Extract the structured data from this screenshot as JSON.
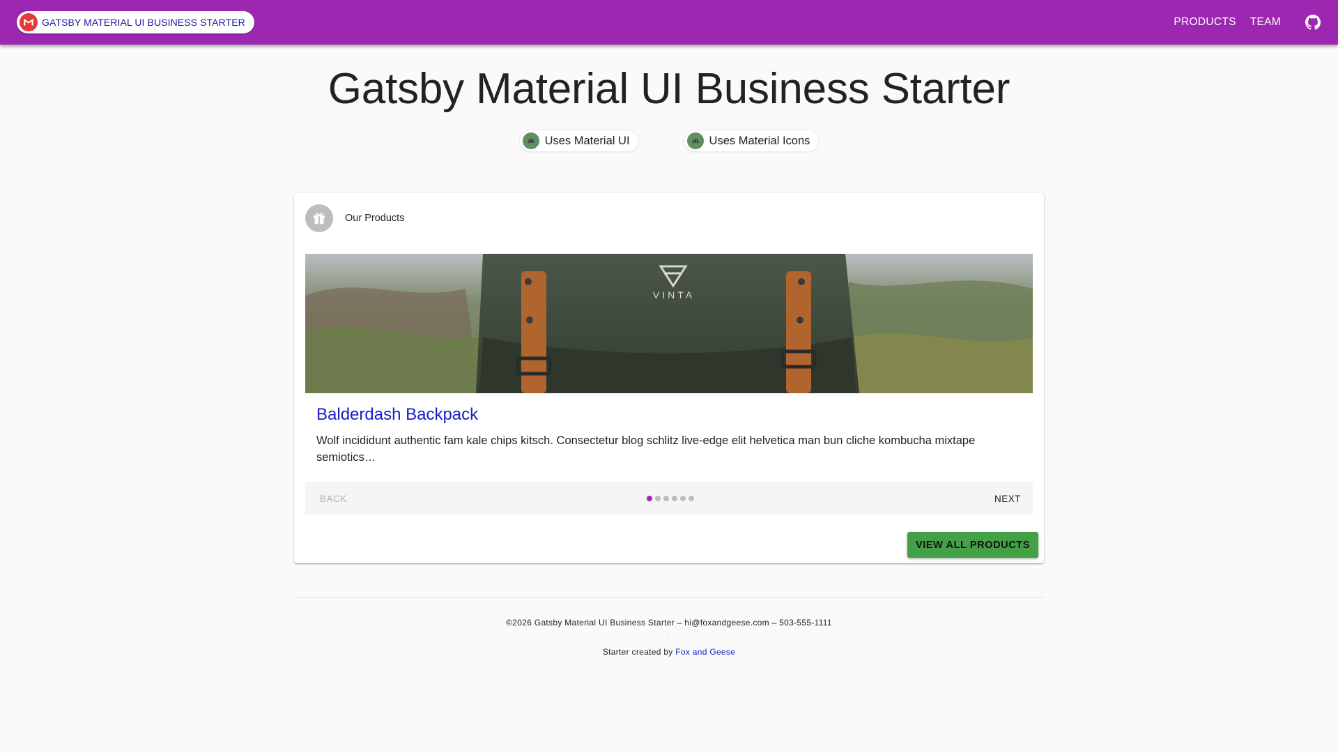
{
  "appbar": {
    "brand_label": "GATSBY MATERIAL UI BUSINESS STARTER",
    "brand_icon": "material-ui-logo-icon",
    "nav": [
      {
        "label": "PRODUCTS"
      },
      {
        "label": "TEAM"
      }
    ],
    "github_icon": "github-icon",
    "color": "#9c27b0"
  },
  "hero": {
    "title": "Gatsby Material UI Business Starter",
    "chips": [
      {
        "label": "Uses Material UI",
        "icon": "android-icon"
      },
      {
        "label": "Uses Material Icons",
        "icon": "android-icon"
      }
    ]
  },
  "products_card": {
    "header_icon": "gift-icon",
    "header_title": "Our Products",
    "image_logo_text": "VINTA",
    "product_name": "Balderdash Backpack",
    "product_description": "Wolf incididunt authentic fam kale chips kitsch. Consectetur blog schlitz live-edge elit helvetica man bun cliche kombucha mixtape semiotics…",
    "stepper": {
      "back_label": "BACK",
      "next_label": "NEXT",
      "total_steps": 6,
      "active_step": 1
    },
    "view_all_label": "VIEW ALL PRODUCTS",
    "view_all_color": "#43a047"
  },
  "footer": {
    "line1": "©2026 Gatsby Material UI Business Starter – hi@foxandgeese.com – 503-555-1111",
    "separator": ".",
    "credit_prefix": "Starter created by ",
    "credit_link": "Fox and Geese"
  }
}
